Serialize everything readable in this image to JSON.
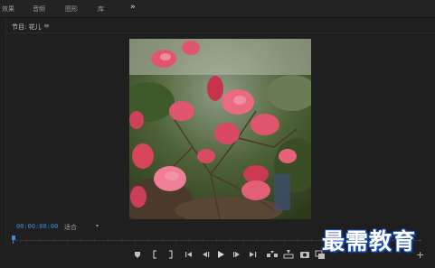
{
  "workspace_tabs": [
    {
      "label": "效果"
    },
    {
      "label": "音频"
    },
    {
      "label": "图形"
    },
    {
      "label": "库"
    }
  ],
  "more_glyph": "»",
  "panel": {
    "title": "节目: 花儿",
    "menu_glyph": "≡"
  },
  "playback": {
    "timecode": "00:00:00:00",
    "fit_label": "适合",
    "caret": "▾"
  },
  "watermark": {
    "text": "最需教育"
  },
  "colors": {
    "accent": "#3f8bd8",
    "background": "#1e1e1e"
  },
  "transport_buttons": [
    {
      "name": "add-marker-icon"
    },
    {
      "name": "mark-in-icon"
    },
    {
      "name": "mark-out-icon"
    },
    {
      "name": "go-to-in-icon"
    },
    {
      "name": "step-back-icon"
    },
    {
      "name": "play-icon"
    },
    {
      "name": "step-forward-icon"
    },
    {
      "name": "go-to-out-icon"
    },
    {
      "name": "insert-icon"
    },
    {
      "name": "overwrite-icon"
    },
    {
      "name": "export-frame-icon"
    },
    {
      "name": "comparison-view-icon"
    }
  ],
  "add_button_glyph": "+"
}
